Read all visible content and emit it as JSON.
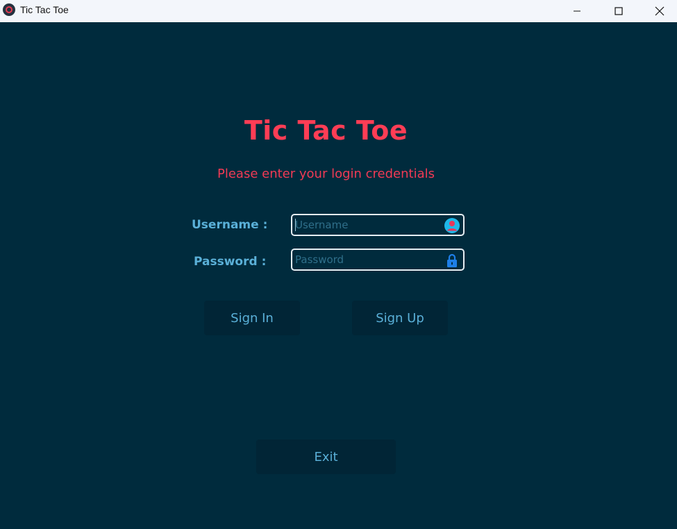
{
  "window": {
    "title": "Tic Tac Toe"
  },
  "header": {
    "title": "Tic Tac Toe",
    "subtitle": "Please enter your login credentials"
  },
  "form": {
    "username_label": "Username :",
    "username_placeholder": "Username",
    "username_value": "",
    "username_icon": "user-icon",
    "password_label": "Password :",
    "password_placeholder": "Password",
    "password_value": "",
    "password_icon": "lock-icon"
  },
  "buttons": {
    "sign_in": "Sign In",
    "sign_up": "Sign Up",
    "exit": "Exit"
  },
  "colors": {
    "background": "#002b3d",
    "title": "#ff3d55",
    "label": "#5ab0d8",
    "button_bg": "#012536"
  }
}
